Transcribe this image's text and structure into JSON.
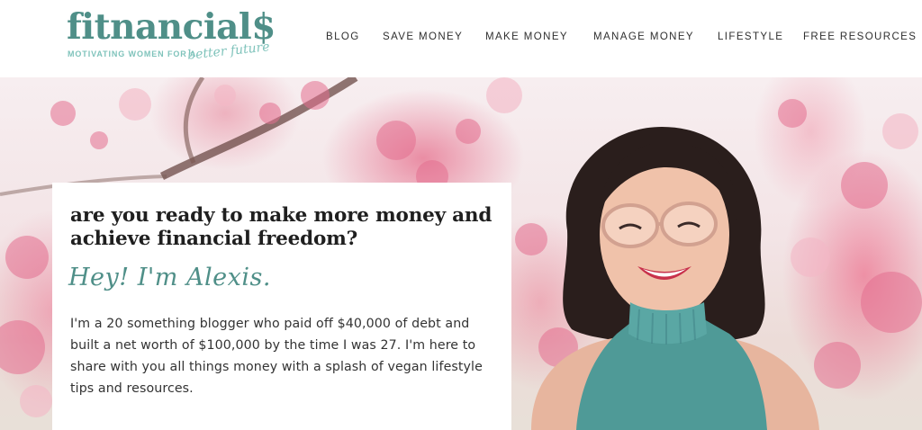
{
  "header": {
    "logo": {
      "word": "fitnancial$",
      "tagline": "MOTIVATING WOMEN FOR A",
      "tagline_script": "better future"
    },
    "nav": [
      {
        "label": "BLOG"
      },
      {
        "label": "SAVE MONEY"
      },
      {
        "label": "MAKE MONEY"
      },
      {
        "label": "MANAGE MONEY"
      },
      {
        "label": "LIFESTYLE"
      },
      {
        "label": "FREE RESOURCES"
      }
    ]
  },
  "hero": {
    "headline": "are you ready to make more money and achieve financial freedom?",
    "greeting": "Hey! I'm Alexis.",
    "body": "I'm a 20 something blogger who paid off $40,000 of debt and built a net worth of $100,000 by the time I was 27. I'm here to share with you all things money with a splash of vegan lifestyle tips and resources."
  },
  "colors": {
    "brand_teal": "#4f8f88",
    "brand_teal_light": "#7fc3bb",
    "blossom_pink": "#e6768f"
  }
}
